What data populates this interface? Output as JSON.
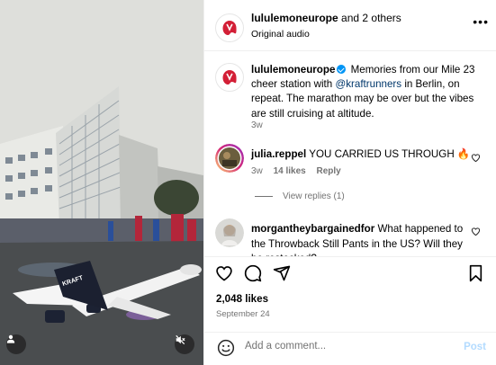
{
  "header": {
    "username": "lululemoneurope",
    "and_others": "and 2 others",
    "audio": "Original audio",
    "more": "•••"
  },
  "caption": {
    "username": "lululemoneurope",
    "text_before": " Memories from our Mile 23 cheer station with ",
    "mention": "@kraftrunners",
    "text_after": " in Berlin, on repeat. The marathon may be over but the vibes are still cruising at altitude.",
    "time": "3w"
  },
  "comments": [
    {
      "username": "julia.reppel",
      "text": " YOU CARRIED US THROUGH 🔥",
      "time": "3w",
      "likes": "14 likes",
      "reply": "Reply",
      "view_replies": "View replies (1)"
    },
    {
      "username": "morgantheybargainedfor",
      "text": " What happened to the Throwback Still Pants in the US? Will they be restocked?"
    }
  ],
  "actions": {
    "likes": "2,048 likes",
    "date": "September 24"
  },
  "add_comment": {
    "placeholder": "Add a comment...",
    "post": "Post"
  },
  "icons": {
    "like": "heart-icon",
    "comment": "comment-icon",
    "share": "share-icon",
    "save": "bookmark-icon",
    "emoji": "emoji-icon",
    "mute": "muted-speaker-icon",
    "tag": "user-tag-icon"
  },
  "colors": {
    "brand_red": "#d31f36",
    "link": "#00376b",
    "verified": "#0095f6",
    "muted_text": "#737373",
    "post_disabled": "#b3dbff"
  }
}
